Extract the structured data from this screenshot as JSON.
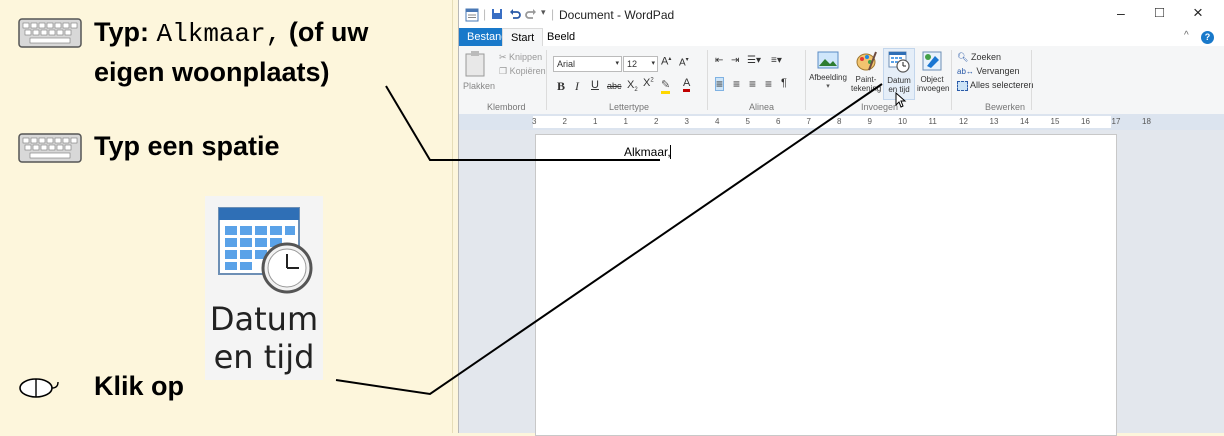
{
  "instructions": {
    "step1_prefix": "Typ:",
    "step1_value": "Alkmaar,",
    "step1_suffix": "(of uw",
    "step1_line2": "eigen woonplaats)",
    "step2": "Typ een spatie",
    "step3": "Klik op",
    "icon_label_line1": "Datum",
    "icon_label_line2": "en tijd"
  },
  "window": {
    "title": "Document - WordPad",
    "tabs": [
      "Bestand",
      "Start",
      "Beeld"
    ],
    "active_tab": "Start",
    "controls": {
      "minimize": "–",
      "maximize": "□",
      "close": "×"
    }
  },
  "ribbon": {
    "clipboard": {
      "paste": "Plakken",
      "cut": "Knippen",
      "copy": "Kopiëren",
      "group": "Klembord"
    },
    "font": {
      "name": "Arial",
      "size": "12",
      "group": "Lettertype"
    },
    "paragraph": {
      "group": "Alinea"
    },
    "insert": {
      "picture": "Afbeelding",
      "paint1": "Paint-",
      "paint2": "tekening",
      "datetime1": "Datum",
      "datetime2": "en tijd",
      "object1": "Object",
      "object2": "invoegen",
      "group": "Invoegen"
    },
    "edit": {
      "find": "Zoeken",
      "replace": "Vervangen",
      "select_all": "Alles selecteren",
      "group": "Bewerken"
    }
  },
  "ruler": {
    "ticks": [
      "3",
      "2",
      "1",
      "1",
      "2",
      "3",
      "4",
      "5",
      "6",
      "7",
      "8",
      "9",
      "10",
      "11",
      "12",
      "13",
      "14",
      "15",
      "16",
      "17",
      "18"
    ]
  },
  "document": {
    "text": "Alkmaar,"
  },
  "colors": {
    "accent": "#1979ca",
    "panel": "#fdf6dc"
  }
}
